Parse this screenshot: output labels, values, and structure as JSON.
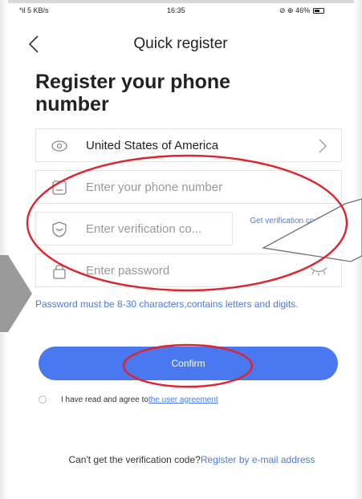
{
  "status_bar": {
    "signal": "*il 5 KB/s",
    "time": "16:35",
    "right": "⊘ ⊕ 46%"
  },
  "nav": {
    "title": "Quick register"
  },
  "heading": "Register your phone number",
  "form": {
    "country": "United States of America",
    "phone_placeholder": "Enter your phone number",
    "code_placeholder": "Enter verification co...",
    "get_code": "Get verification code",
    "password_placeholder": "Enter password"
  },
  "hint": "Password must be 8-30 characters,contains letters and digits.",
  "confirm_label": "Confirm",
  "agreement": {
    "text": "I have read and agree to",
    "link": "the user agreement"
  },
  "footer": {
    "text": "Can't get the verification code?",
    "link": "Register by e-mail address"
  },
  "colors": {
    "accent": "#4a78f0",
    "annotation": "#e0222a",
    "pointer": "#9a9a9a"
  }
}
